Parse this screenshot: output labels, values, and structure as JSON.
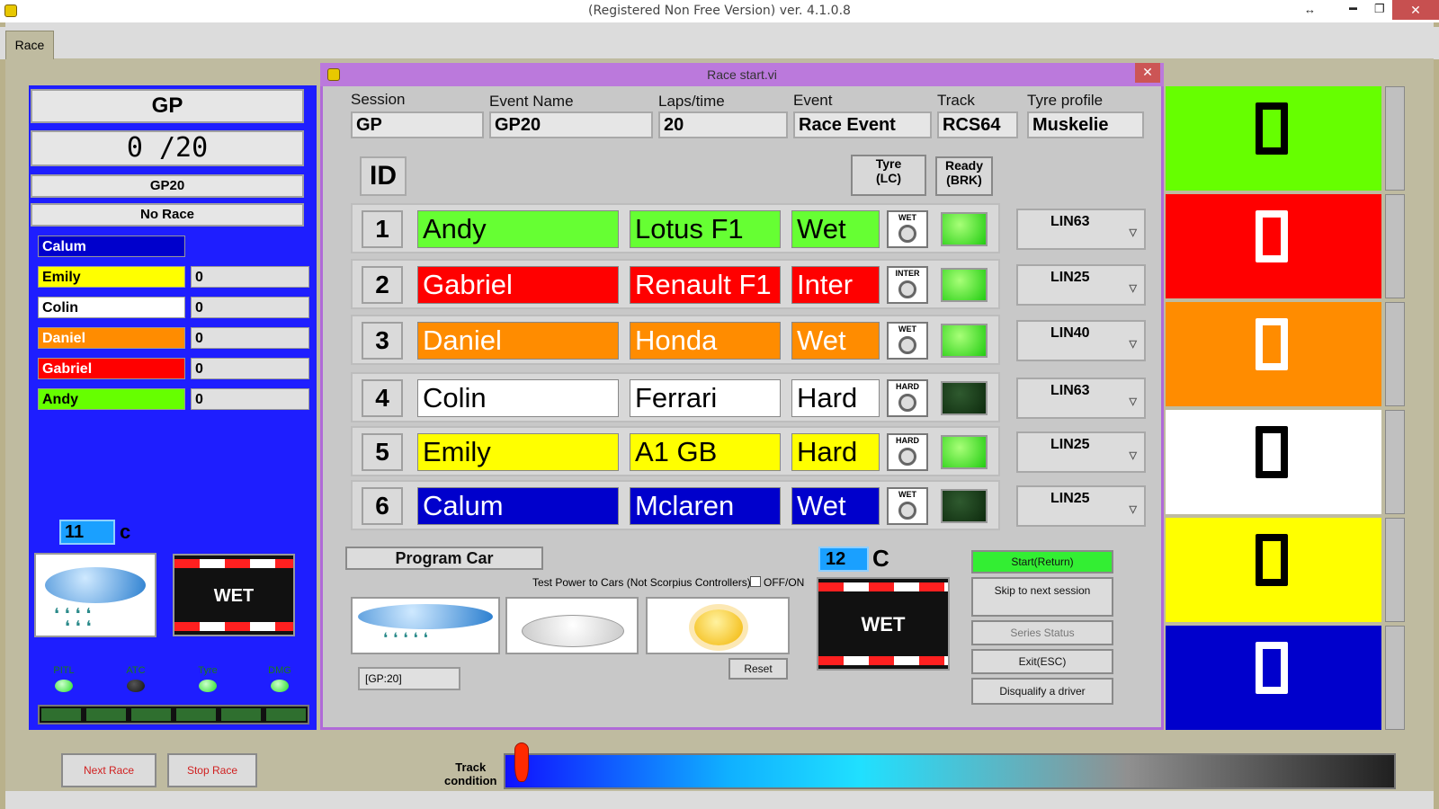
{
  "window": {
    "title": "(Registered Non Free Version)  ver. 4.1.0.8",
    "ctl_resize": "↔",
    "ctl_min": "▬",
    "ctl_max": "❐",
    "ctl_close": "✕"
  },
  "tab": {
    "label": "Race"
  },
  "left": {
    "session": "GP",
    "laps": "0 /20",
    "event": "GP20",
    "status": "No Race",
    "drivers": [
      {
        "name": "Calum",
        "score": "",
        "color": "#0000cc",
        "text": "#ffffff"
      },
      {
        "name": "Emily",
        "score": "0",
        "color": "#ffff00",
        "text": "#000000"
      },
      {
        "name": "Colin",
        "score": "0",
        "color": "#ffffff",
        "text": "#000000"
      },
      {
        "name": "Daniel",
        "score": "0",
        "color": "#ff8c00",
        "text": "#ffffff"
      },
      {
        "name": "Gabriel",
        "score": "0",
        "color": "#ff0000",
        "text": "#ffffff"
      },
      {
        "name": "Andy",
        "score": "0",
        "color": "#66ff00",
        "text": "#000000"
      }
    ],
    "temp": "11",
    "temp_unit": "c",
    "track_state": "WET",
    "leds": [
      {
        "label": "PITL",
        "on": true
      },
      {
        "label": "ATC",
        "on": false
      },
      {
        "label": "Tyre",
        "on": true
      },
      {
        "label": "DMG",
        "on": true
      }
    ]
  },
  "dialog": {
    "title": "Race start.vi",
    "close": "✕",
    "headers": {
      "session": "Session",
      "event_name": "Event Name",
      "laps": "Laps/time",
      "event": "Event",
      "track": "Track",
      "tyre_profile": "Tyre profile"
    },
    "values": {
      "session": "GP",
      "event_name": "GP20",
      "laps": "20",
      "event": "Race Event",
      "track": "RCS64",
      "tyre_profile": "Muskelie"
    },
    "id_label": "ID",
    "tyre_hdr": [
      "Tyre",
      "(LC)"
    ],
    "ready_hdr": [
      "Ready",
      "(BRK)"
    ],
    "rows": [
      {
        "id": "1",
        "driver": "Andy",
        "car": "Lotus F1",
        "tyre": "Wet",
        "tyre_icon": "WET",
        "ready": true,
        "controller": "LIN63",
        "color": "#66ff33",
        "text": "#000000"
      },
      {
        "id": "2",
        "driver": "Gabriel",
        "car": "Renault F1",
        "tyre": "Inter",
        "tyre_icon": "INTER",
        "ready": true,
        "controller": "LIN25",
        "color": "#ff0000",
        "text": "#ffffff"
      },
      {
        "id": "3",
        "driver": "Daniel",
        "car": "Honda",
        "tyre": "Wet",
        "tyre_icon": "WET",
        "ready": true,
        "controller": "LIN40",
        "color": "#ff8c00",
        "text": "#ffffff"
      },
      {
        "id": "4",
        "driver": "Colin",
        "car": "Ferrari",
        "tyre": "Hard",
        "tyre_icon": "HARD",
        "ready": false,
        "controller": "LIN63",
        "color": "#ffffff",
        "text": "#000000"
      },
      {
        "id": "5",
        "driver": "Emily",
        "car": "A1 GB",
        "tyre": "Hard",
        "tyre_icon": "HARD",
        "ready": true,
        "controller": "LIN25",
        "color": "#ffff00",
        "text": "#000000"
      },
      {
        "id": "6",
        "driver": "Calum",
        "car": "Mclaren",
        "tyre": "Wet",
        "tyre_icon": "WET",
        "ready": false,
        "controller": "LIN25",
        "color": "#0000cc",
        "text": "#ffffff"
      }
    ],
    "program_car": "Program Car",
    "test_power": "Test Power to Cars (Not Scorpius Controllers)",
    "offon": "OFF/ON",
    "gp_tag": "[GP:20]",
    "reset": "Reset",
    "temp": "12",
    "temp_unit": "C",
    "track_state": "WET",
    "buttons": {
      "start": "Start(Return)",
      "skip": "Skip to next session",
      "series": "Series Status",
      "exit": "Exit(ESC)",
      "dq": "Disqualify a driver"
    }
  },
  "right_blocks": [
    {
      "color": "#66ff00",
      "digit": "0",
      "digit_color": "#000000"
    },
    {
      "color": "#ff0000",
      "digit": "0",
      "digit_color": "#ffffff"
    },
    {
      "color": "#ff8c00",
      "digit": "0",
      "digit_color": "#ffffff"
    },
    {
      "color": "#ffffff",
      "digit": "0",
      "digit_color": "#000000"
    },
    {
      "color": "#ffff00",
      "digit": "0",
      "digit_color": "#000000"
    },
    {
      "color": "#0000cc",
      "digit": "0",
      "digit_color": "#ffffff"
    }
  ],
  "bottom": {
    "next_race": "Next Race",
    "stop_race": "Stop Race",
    "track_cond": [
      "Track",
      "condition"
    ],
    "track_condition_level": 0.01
  }
}
